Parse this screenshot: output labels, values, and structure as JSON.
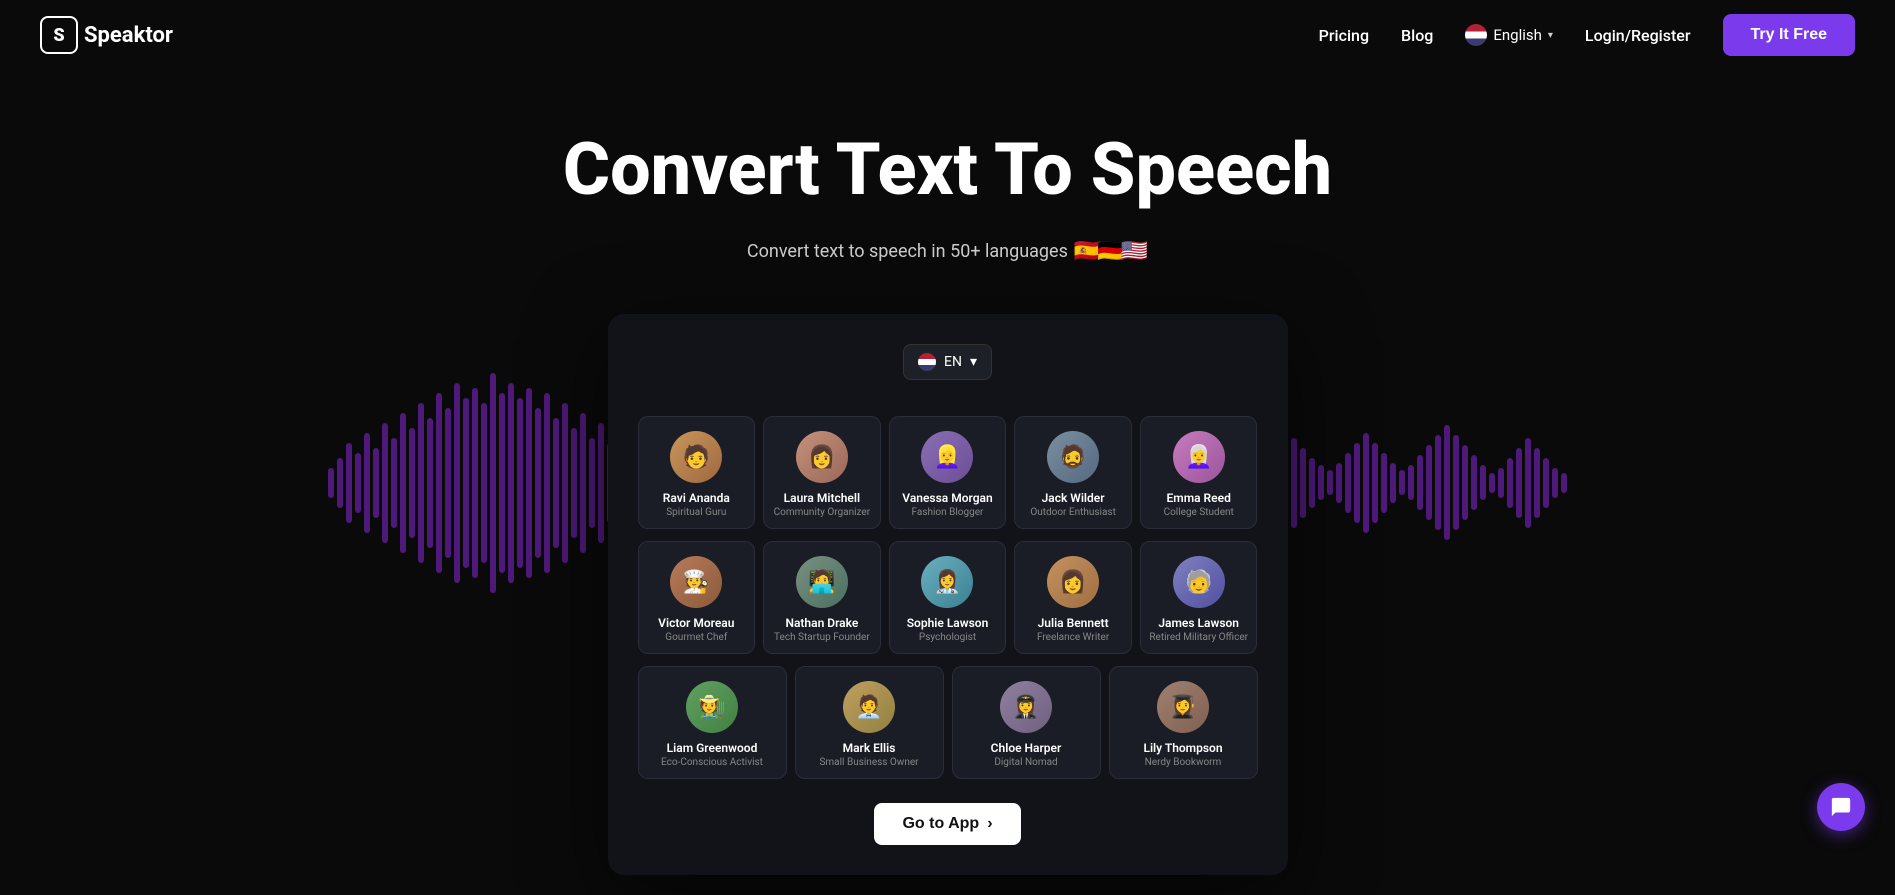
{
  "nav": {
    "logo_text": "Speaktor",
    "logo_icon": "S",
    "links": [
      {
        "label": "Pricing",
        "key": "pricing"
      },
      {
        "label": "Blog",
        "key": "blog"
      }
    ],
    "language": "English",
    "login_label": "Login/Register",
    "try_btn": "Try It Free"
  },
  "hero": {
    "title": "Convert Text To Speech",
    "subtitle": "Convert text to speech in 50+ languages"
  },
  "demo": {
    "lang_selector": "EN",
    "voices_row1": [
      {
        "name": "Ravi Ananda",
        "role": "Spiritual Guru",
        "av": "av-1"
      },
      {
        "name": "Laura Mitchell",
        "role": "Community Organizer",
        "av": "av-2"
      },
      {
        "name": "Vanessa Morgan",
        "role": "Fashion Blogger",
        "av": "av-3"
      },
      {
        "name": "Jack Wilder",
        "role": "Outdoor Enthusiast",
        "av": "av-4"
      },
      {
        "name": "Emma Reed",
        "role": "College Student",
        "av": "av-5"
      }
    ],
    "voices_row2": [
      {
        "name": "Victor Moreau",
        "role": "Gourmet Chef",
        "av": "av-6"
      },
      {
        "name": "Nathan Drake",
        "role": "Tech Startup Founder",
        "av": "av-7"
      },
      {
        "name": "Sophie Lawson",
        "role": "Psychologist",
        "av": "av-8"
      },
      {
        "name": "Julia Bennett",
        "role": "Freelance Writer",
        "av": "av-9"
      },
      {
        "name": "James Lawson",
        "role": "Retired Military Officer",
        "av": "av-10"
      }
    ],
    "voices_row3": [
      {
        "name": "Liam Greenwood",
        "role": "Eco-Conscious Activist",
        "av": "av-11"
      },
      {
        "name": "Mark Ellis",
        "role": "Small Business Owner",
        "av": "av-12"
      },
      {
        "name": "Chloe Harper",
        "role": "Digital Nomad",
        "av": "av-13"
      },
      {
        "name": "Lily Thompson",
        "role": "Nerdy Bookworm",
        "av": "av-14"
      }
    ],
    "goto_btn": "Go to App"
  },
  "chat_icon": "💬"
}
